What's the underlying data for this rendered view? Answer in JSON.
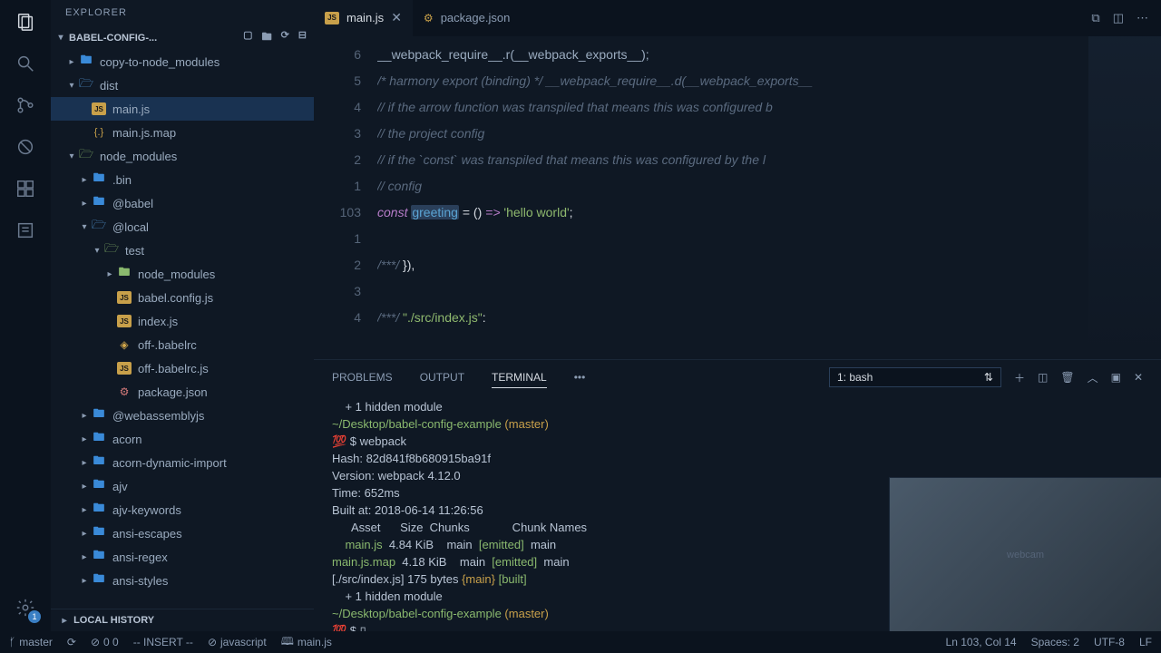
{
  "sidebar": {
    "title": "EXPLORER",
    "project": "BABEL-CONFIG-...",
    "localHistory": "LOCAL HISTORY",
    "tree": [
      {
        "depth": 0,
        "type": "folder",
        "expanded": false,
        "label": "copy-to-node_modules",
        "icon": "folder"
      },
      {
        "depth": 0,
        "type": "folder",
        "expanded": true,
        "label": "dist",
        "icon": "folder open"
      },
      {
        "depth": 1,
        "type": "file",
        "label": "main.js",
        "icon": "js",
        "selected": true
      },
      {
        "depth": 1,
        "type": "file",
        "label": "main.js.map",
        "icon": "map"
      },
      {
        "depth": 0,
        "type": "folder",
        "expanded": true,
        "label": "node_modules",
        "icon": "folder green"
      },
      {
        "depth": 1,
        "type": "folder",
        "expanded": false,
        "label": ".bin",
        "icon": "folder"
      },
      {
        "depth": 1,
        "type": "folder",
        "expanded": false,
        "label": "@babel",
        "icon": "folder"
      },
      {
        "depth": 1,
        "type": "folder",
        "expanded": true,
        "label": "@local",
        "icon": "folder open"
      },
      {
        "depth": 2,
        "type": "folder",
        "expanded": true,
        "label": "test",
        "icon": "folder green"
      },
      {
        "depth": 3,
        "type": "folder",
        "expanded": false,
        "label": "node_modules",
        "icon": "folder green"
      },
      {
        "depth": 3,
        "type": "file",
        "label": "babel.config.js",
        "icon": "js"
      },
      {
        "depth": 3,
        "type": "file",
        "label": "index.js",
        "icon": "js"
      },
      {
        "depth": 3,
        "type": "file",
        "label": "off-.babelrc",
        "icon": "babel"
      },
      {
        "depth": 3,
        "type": "file",
        "label": "off-.babelrc.js",
        "icon": "js"
      },
      {
        "depth": 3,
        "type": "file",
        "label": "package.json",
        "icon": "json",
        "red": true
      },
      {
        "depth": 1,
        "type": "folder",
        "expanded": false,
        "label": "@webassemblyjs",
        "icon": "folder"
      },
      {
        "depth": 1,
        "type": "folder",
        "expanded": false,
        "label": "acorn",
        "icon": "folder"
      },
      {
        "depth": 1,
        "type": "folder",
        "expanded": false,
        "label": "acorn-dynamic-import",
        "icon": "folder"
      },
      {
        "depth": 1,
        "type": "folder",
        "expanded": false,
        "label": "ajv",
        "icon": "folder"
      },
      {
        "depth": 1,
        "type": "folder",
        "expanded": false,
        "label": "ajv-keywords",
        "icon": "folder"
      },
      {
        "depth": 1,
        "type": "folder",
        "expanded": false,
        "label": "ansi-escapes",
        "icon": "folder"
      },
      {
        "depth": 1,
        "type": "folder",
        "expanded": false,
        "label": "ansi-regex",
        "icon": "folder"
      },
      {
        "depth": 1,
        "type": "folder",
        "expanded": false,
        "label": "ansi-styles",
        "icon": "folder"
      }
    ]
  },
  "tabs": {
    "items": [
      {
        "label": "main.js",
        "icon": "js",
        "active": true,
        "dirty": false
      },
      {
        "label": "package.json",
        "icon": "json",
        "active": false,
        "dirty": false
      }
    ]
  },
  "editor": {
    "gutterLines": [
      "6",
      "5",
      "4",
      "3",
      "2",
      "1",
      "103",
      "1",
      "2",
      "3",
      "4"
    ],
    "code": [
      {
        "html": "__webpack_require__.r(__webpack_exports__);",
        "cls": "normal"
      },
      {
        "html": "/* harmony export (binding) */ __webpack_require__.d(__webpack_exports__",
        "cls": "c"
      },
      {
        "html": "// if the arrow function was transpiled that means this was configured b",
        "cls": "c"
      },
      {
        "html": "// the project config",
        "cls": "c"
      },
      {
        "html": "// if the `const` was transpiled that means this was configured by the l",
        "cls": "c"
      },
      {
        "html": "// config",
        "cls": "c"
      },
      {
        "html": "<span class='k'>const</span> <span class='f hl'>greeting</span> <span class='v'>=</span> <span class='v'>()</span> <span class='k'>=></span> <span class='s'>'hello world'</span><span class='v'>;</span>",
        "cls": "normal"
      },
      {
        "html": "",
        "cls": ""
      },
      {
        "html": "<span class='c'>/***/</span> <span class='v'>}),</span>",
        "cls": "normal"
      },
      {
        "html": "",
        "cls": ""
      },
      {
        "html": "<span class='c'>/***/</span> <span class='s'>\"./src/index.js\"</span><span class='v'>:</span>",
        "cls": "normal"
      }
    ]
  },
  "panel": {
    "tabs": {
      "problems": "PROBLEMS",
      "output": "OUTPUT",
      "terminal": "TERMINAL"
    },
    "select": "1: bash",
    "terminal": [
      {
        "t": "    + 1 hidden module",
        "c": ""
      },
      {
        "t": "~/Desktop/babel-config-example",
        "c": "term-green",
        "suffix": " (master)",
        "sc": "term-yellow"
      },
      {
        "t": "💯 $ webpack",
        "c": ""
      },
      {
        "t": "Hash: 82d841f8b680915ba91f",
        "c": ""
      },
      {
        "t": "Version: webpack 4.12.0",
        "c": ""
      },
      {
        "t": "Time: 652ms",
        "c": ""
      },
      {
        "t": "Built at: 2018-06-14 11:26:56",
        "c": ""
      },
      {
        "t": "      Asset      Size  Chunks             Chunk Names",
        "c": ""
      },
      {
        "t": "    main.js  4.84 KiB    main  [emitted]  main",
        "c": "",
        "spans": [
          {
            "t": "    ",
            "c": ""
          },
          {
            "t": "main.js",
            "c": "term-green"
          },
          {
            "t": "  4.84 KiB    main  ",
            "c": ""
          },
          {
            "t": "[emitted]",
            "c": "term-green"
          },
          {
            "t": "  main",
            "c": ""
          }
        ]
      },
      {
        "t": "",
        "spans": [
          {
            "t": "main.js.map",
            "c": "term-green"
          },
          {
            "t": "  4.18 KiB    main  ",
            "c": ""
          },
          {
            "t": "[emitted]",
            "c": "term-green"
          },
          {
            "t": "  main",
            "c": ""
          }
        ]
      },
      {
        "t": "",
        "spans": [
          {
            "t": "[./src/index.js] 175 bytes ",
            "c": ""
          },
          {
            "t": "{main}",
            "c": "term-yellow"
          },
          {
            "t": " ",
            "c": ""
          },
          {
            "t": "[built]",
            "c": "term-green"
          }
        ]
      },
      {
        "t": "    + 1 hidden module",
        "c": ""
      },
      {
        "t": "~/Desktop/babel-config-example",
        "c": "term-green",
        "suffix": " (master)",
        "sc": "term-yellow"
      },
      {
        "t": "💯 $ ▯",
        "c": ""
      }
    ]
  },
  "statusbar": {
    "branch": "master",
    "sync": "⟳",
    "errors": "0  0",
    "mode": "-- INSERT --",
    "lang": "javascript",
    "file": "main.js",
    "pos": "Ln 103, Col 14",
    "spaces": "Spaces: 2",
    "encoding": "UTF-8",
    "eol": "LF"
  },
  "activityBadge": "1"
}
